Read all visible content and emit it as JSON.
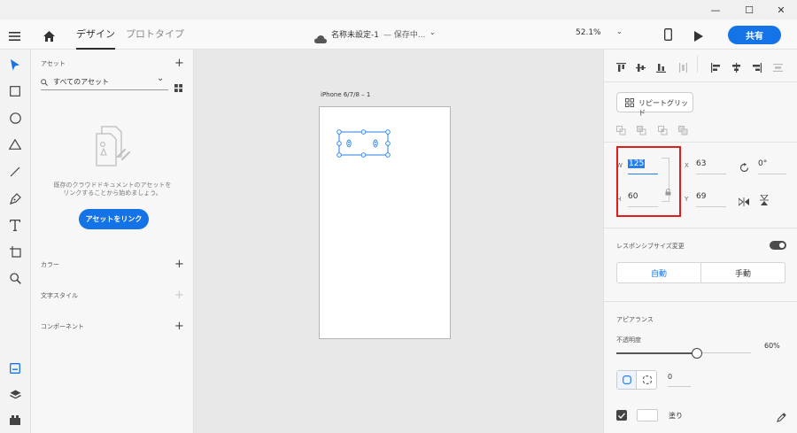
{
  "window": {
    "minimize": "—",
    "maximize": "☐",
    "close": "✕"
  },
  "header": {
    "tabs": [
      {
        "label": "デザイン"
      },
      {
        "label": "プロトタイプ"
      }
    ],
    "document_title": "名称未設定-1",
    "save_status": "— 保存中...",
    "zoom": "52.1%",
    "share_label": "共有"
  },
  "assets": {
    "title": "アセット",
    "filter_label": "すべてのアセット",
    "empty_message_line1": "既存のクラウドドキュメントのアセットを",
    "empty_message_line2": "リンクすることから始めましょう。",
    "link_button": "アセットをリンク",
    "sections": [
      {
        "label": "カラー"
      },
      {
        "label": "文字スタイル"
      },
      {
        "label": "コンポーネント"
      }
    ]
  },
  "canvas": {
    "artboard_label": "iPhone 6/7/8 – 1"
  },
  "properties": {
    "repeat_grid": "リピートグリッド",
    "w_label": "W",
    "w_value": "125",
    "h_label": "H",
    "h_value": "60",
    "x_label": "X",
    "x_value": "63",
    "y_label": "Y",
    "y_value": "69",
    "rotation_value": "0°",
    "responsive_resize": "レスポンシブサイズ変更",
    "auto_label": "自動",
    "manual_label": "手動",
    "appearance": "アピアランス",
    "opacity_label": "不透明度",
    "opacity_value": "60%",
    "opacity_level": 0.6,
    "corner_radius_value": "0",
    "fill_label": "塗り"
  },
  "colors": {
    "accent": "#1473e6",
    "highlight": "#e01d1d",
    "selection": "#2680eb"
  }
}
